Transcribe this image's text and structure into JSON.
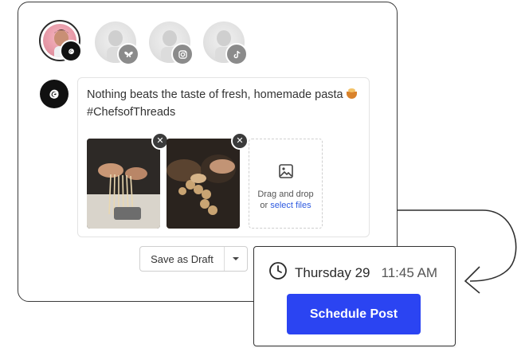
{
  "accounts": [
    {
      "name": "threads-account",
      "active": true,
      "network_icon": "threads-icon"
    },
    {
      "name": "bluesky-account",
      "active": false,
      "network_icon": "butterfly-icon"
    },
    {
      "name": "instagram-account",
      "active": false,
      "network_icon": "instagram-icon"
    },
    {
      "name": "tiktok-account",
      "active": false,
      "network_icon": "tiktok-icon"
    }
  ],
  "composer": {
    "network_icon": "threads-icon",
    "text_line1": "Nothing beats the taste of fresh, homemade pasta",
    "text_line2": "#ChefsofThreads",
    "emoji": "pasta-emoji",
    "media": [
      {
        "name": "pasta-photo-1",
        "remove_label": "✕"
      },
      {
        "name": "pasta-photo-2",
        "remove_label": "✕"
      }
    ],
    "dropzone": {
      "icon": "image-icon",
      "line1": "Drag and drop",
      "line2_prefix": "or ",
      "line2_link": "select files"
    }
  },
  "actions": {
    "save_draft_label": "Save as Draft",
    "dropdown_icon": "caret-down-icon"
  },
  "schedule": {
    "clock_icon": "clock-icon",
    "day": "Thursday 29",
    "time": "11:45 AM",
    "button_label": "Schedule Post"
  },
  "colors": {
    "accent": "#2b44f2",
    "link": "#2f5be0",
    "dark": "#111111"
  }
}
